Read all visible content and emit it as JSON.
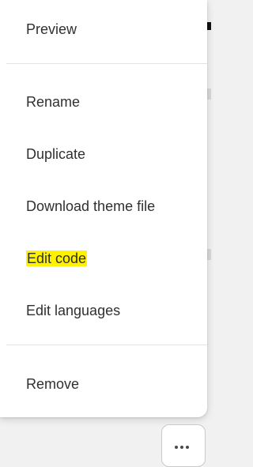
{
  "menu": {
    "items": [
      {
        "label": "Preview"
      },
      {
        "label": "Rename"
      },
      {
        "label": "Duplicate"
      },
      {
        "label": "Download theme file"
      },
      {
        "label": "Edit code"
      },
      {
        "label": "Edit languages"
      },
      {
        "label": "Remove"
      }
    ],
    "highlight_color": "#fff200"
  },
  "more_button": {
    "icon": "ellipsis-icon"
  }
}
